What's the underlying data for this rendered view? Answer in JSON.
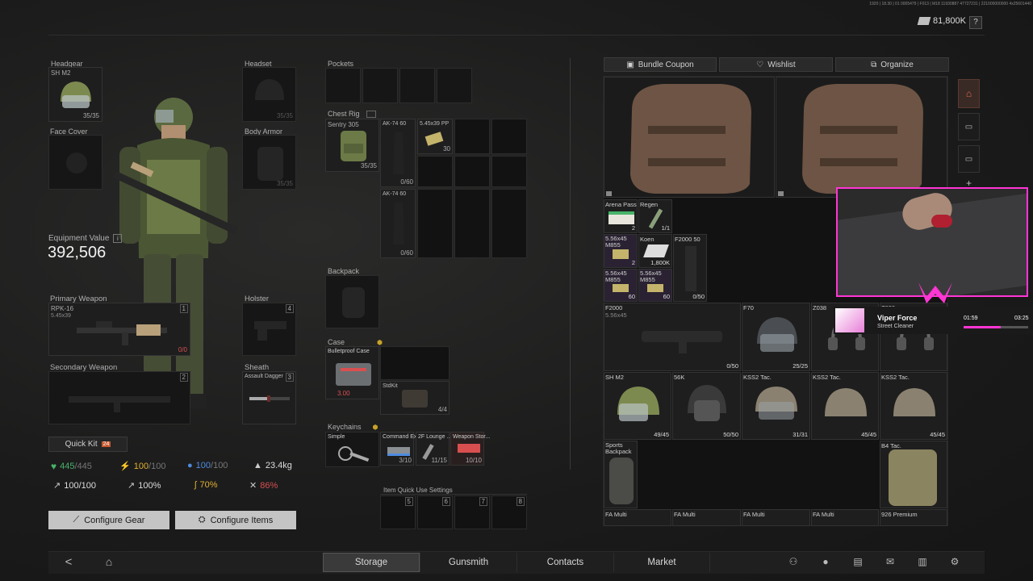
{
  "topbar": {
    "debug": "1920 | 18.30 | 01 0005479 | F013 | M18 11930887 47727231 | 221000000000 4x25601440",
    "currency": "81,800K",
    "help": "?"
  },
  "gear": {
    "headgear_label": "Headgear",
    "headgear_item": "SH M2",
    "headgear_dur": "35/35",
    "headset_label": "Headset",
    "headset_dur": "35/35",
    "face_cover_label": "Face Cover",
    "body_armor_label": "Body Armor",
    "body_armor_dur": "35/35",
    "primary_label": "Primary Weapon",
    "primary_item": "RPK-16",
    "primary_ammo": "5.45x39",
    "primary_slot": "1",
    "primary_mag": "0/0",
    "holster_label": "Holster",
    "holster_slot": "4",
    "secondary_label": "Secondary Weapon",
    "secondary_slot": "2",
    "sheath_label": "Sheath",
    "sheath_item": "Assault Dagger",
    "sheath_slot": "3"
  },
  "equipment": {
    "label": "Equipment Value",
    "info": "i",
    "value": "392,506"
  },
  "quick_kit": {
    "label": "Quick Kit",
    "badge": "24"
  },
  "stats": {
    "health": "445",
    "health_max": "/445",
    "energy": "100",
    "energy_max": "/100",
    "water": "100",
    "water_max": "/100",
    "weight": "23.4kg",
    "stat1": "100/100",
    "stat2": "100%",
    "stat3": "70%",
    "stat4": "86%"
  },
  "buttons": {
    "configure_gear": "Configure Gear",
    "configure_items": "Configure Items"
  },
  "middle": {
    "pockets": "Pockets",
    "chest_rig": "Chest Rig",
    "rig_item": "Sentry 305",
    "rig_dur": "35/35",
    "ak1": "AK-74 60",
    "ak1_count": "0/60",
    "ammo": "5.45x39 PP",
    "ammo_count": "30",
    "ak2": "AK-74 60",
    "ak2_count": "0/60",
    "backpack": "Backpack",
    "case_label": "Case",
    "case_item": "Bulletproof Case",
    "case_value": "3.00",
    "stdkit": "StdKit",
    "stdkit_count": "4/4",
    "keychains": "Keychains",
    "key_simple": "Simple",
    "key1": "Command Exit...",
    "key1_count": "3/10",
    "key2": "2F Lounge ...",
    "key2_count": "11/15",
    "key3": "Weapon Stor...",
    "key3_count": "10/10",
    "quick_use": "Item Quick Use Settings",
    "qs": [
      "5",
      "6",
      "7",
      "8"
    ]
  },
  "storage": {
    "bundle": "Bundle Coupon",
    "wishlist": "Wishlist",
    "organize": "Organize",
    "items": {
      "arena": "Arena Pass",
      "arena_count": "2",
      "regen": "Regen",
      "regen_count": "1/1",
      "ammo1": "5.56x45 M855",
      "ammo1_count": "2",
      "koen": "Koen",
      "koen_count": "1,800K",
      "f2000_50": "F2000 50",
      "f2000_50_count": "0/50",
      "ammo2": "5.56x45 M855",
      "ammo2_count": "60",
      "ammo3": "5.56x45 M855",
      "ammo3_count": "60",
      "f2000": "F2000",
      "f2000_ammo": "5.56x45",
      "f2000_count": "0/50",
      "f70": "F70",
      "f70_count": "25/25",
      "z038": "Z038",
      "z038b": "Z038",
      "shm2": "SH M2",
      "shm2_count": "49/45",
      "s6k": "56K",
      "s6k_count": "50/50",
      "kss1": "KSS2 Tac.",
      "kss1_count": "31/31",
      "kss2": "KSS2 Tac.",
      "kss2_count": "45/45",
      "kss3": "KSS2 Tac.",
      "kss3_count": "45/45",
      "sports": "Sports Backpack",
      "b4tac": "B4 Tac.",
      "fa1": "FA Multi",
      "fa2": "FA Multi",
      "fa3": "FA Multi",
      "fa4": "FA Multi",
      "premium": "926 Premium"
    }
  },
  "overlay": {
    "song": "Viper Force",
    "artist": "Street Cleaner",
    "time_now": "01:59",
    "time_total": "03:25",
    "progress": 0.58
  },
  "nav": {
    "back": "<",
    "tabs": [
      "Storage",
      "Gunsmith",
      "Contacts",
      "Market"
    ]
  },
  "colors": {
    "accent": "#c9a227",
    "health": "#47b36a",
    "energy": "#e1b132",
    "water": "#4e8ce0",
    "danger": "#d94f4f",
    "pink": "#ff35d4"
  }
}
